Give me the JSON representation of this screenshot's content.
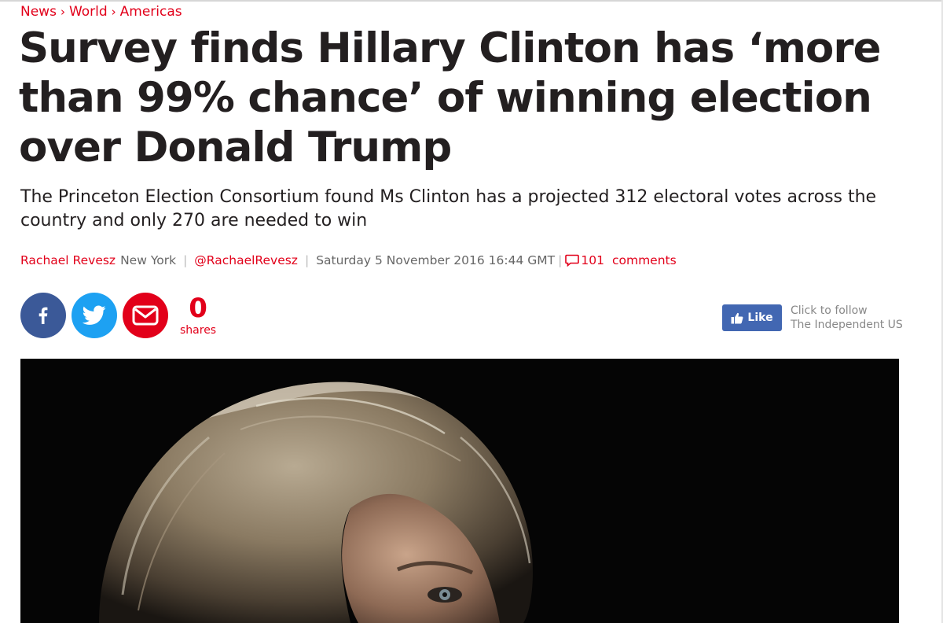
{
  "breadcrumb": {
    "items": [
      "News",
      "World",
      "Americas"
    ],
    "separator": "›"
  },
  "article": {
    "headline": "Survey finds Hillary Clinton has ‘more than 99% chance’ of winning election over Donald Trump",
    "standfirst": "The Princeton Election Consortium found Ms Clinton has a projected 312 electoral votes across the country and only 270 are needed to win"
  },
  "byline": {
    "author": "Rachael Revesz",
    "location": "New York",
    "twitter": "@RachaelRevesz",
    "date": "Saturday 5 November 2016 16:44 GMT",
    "comments_count": "101",
    "comments_label": "comments"
  },
  "share": {
    "count": "0",
    "label": "shares",
    "buttons": [
      "facebook-icon",
      "twitter-icon",
      "email-icon"
    ]
  },
  "follow": {
    "like_label": "Like",
    "line1": "Click to follow",
    "line2": "The Independent US"
  },
  "colors": {
    "accent": "#e2001a",
    "facebook": "#3b5998",
    "twitter": "#1da1f2",
    "like": "#4267b2",
    "headline": "#231f20"
  }
}
